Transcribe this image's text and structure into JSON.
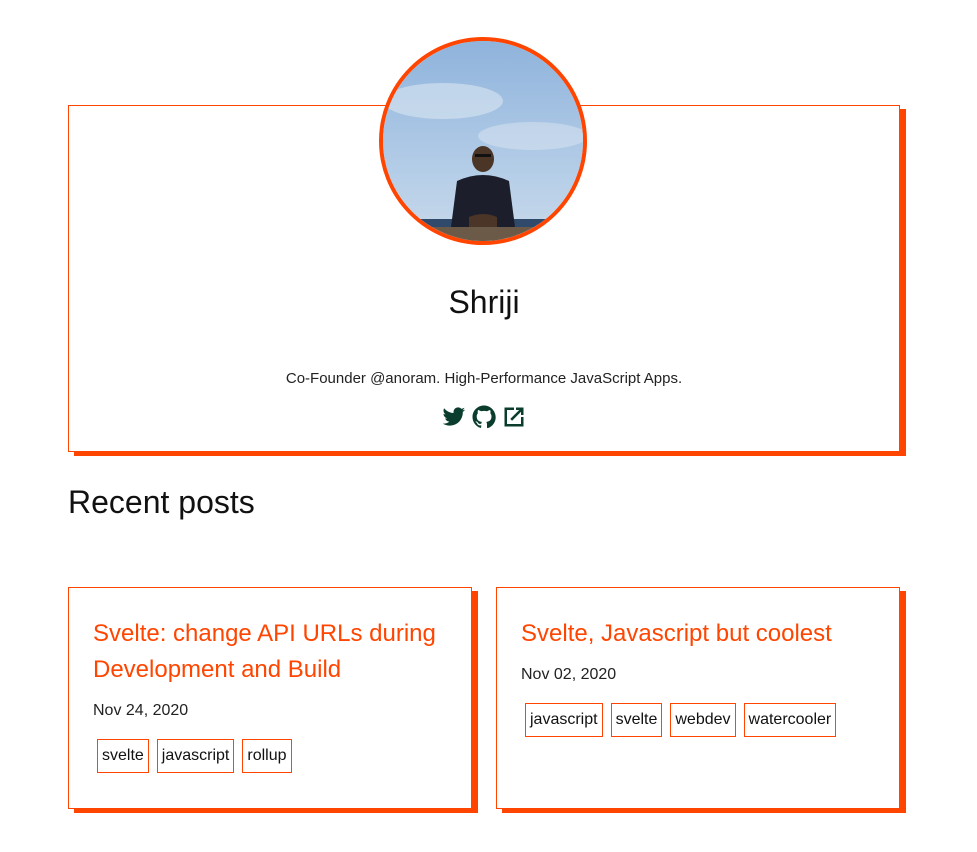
{
  "profile": {
    "name": "Shriji",
    "bio": "Co-Founder @anoram. High-Performance JavaScript Apps.",
    "social": [
      {
        "icon": "twitter-icon"
      },
      {
        "icon": "github-icon"
      },
      {
        "icon": "external-link-icon"
      }
    ]
  },
  "recent": {
    "title": "Recent posts"
  },
  "posts": [
    {
      "title": "Svelte: change API URLs during Development and Build",
      "date": "Nov 24, 2020",
      "tags": [
        "svelte",
        "javascript",
        "rollup"
      ]
    },
    {
      "title": "Svelte, Javascript but coolest",
      "date": "Nov 02, 2020",
      "tags": [
        "javascript",
        "svelte",
        "webdev",
        "watercooler"
      ]
    }
  ],
  "colors": {
    "accent": "#ff4500",
    "icon": "#0b3d2e"
  }
}
